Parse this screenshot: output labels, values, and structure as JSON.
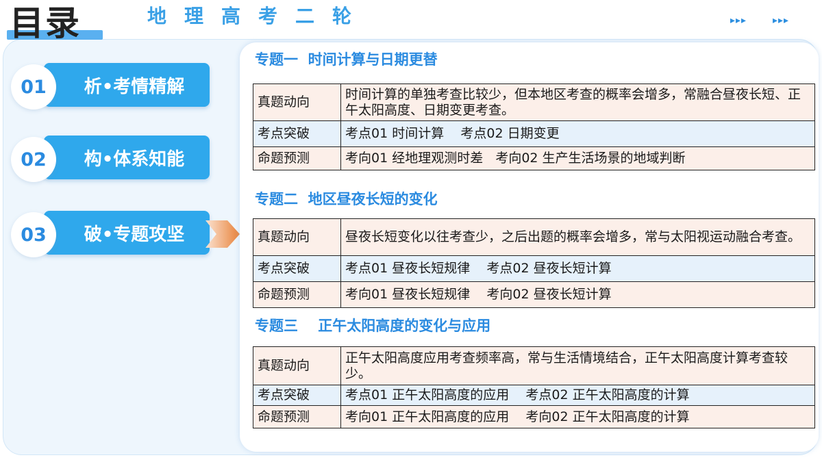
{
  "header": {
    "title": "目录",
    "subject": "地理高考二轮",
    "arrows_left": "▸▸▸",
    "arrows_right": "▸▸▸"
  },
  "nav": {
    "items": [
      {
        "number": "01",
        "label": "析•考情精解"
      },
      {
        "number": "02",
        "label": "构•体系知能"
      },
      {
        "number": "03",
        "label": "破•专题攻坚"
      }
    ],
    "active_index": 2
  },
  "topics": [
    {
      "title": "专题一  时间计算与日期更替",
      "rows": [
        {
          "label": "真题动向",
          "value": "时间计算的单独考查比较少，但本地区考查的概率会增多，常融合昼夜长短、正午太阳高度、日期变更考查。"
        },
        {
          "label": "考点突破",
          "value": "考点01 时间计算    考点02 日期变更"
        },
        {
          "label": "命题预测",
          "value": "考向01 经地理观测时差   考向02 生产生活场景的地域判断"
        }
      ]
    },
    {
      "title": "专题二  地区昼夜长短的变化",
      "rows": [
        {
          "label": "真题动向",
          "value": "昼夜长短变化以往考查少，之后出题的概率会增多，常与太阳视运动融合考查。"
        },
        {
          "label": "考点突破",
          "value": "考点01 昼夜长短规律    考点02 昼夜长短计算"
        },
        {
          "label": "命题预测",
          "value": "考向01 昼夜长短规律    考向02 昼夜长短计算"
        }
      ]
    },
    {
      "title": "专题三    正午太阳高度的变化与应用",
      "rows": [
        {
          "label": "真题动向",
          "value": "正午太阳高度应用考查频率高，常与生活情境结合，正午太阳高度计算考查较少。"
        },
        {
          "label": "考点突破",
          "value": "考点01 正午太阳高度的应用    考点02 正午太阳高度的计算"
        },
        {
          "label": "命题预测",
          "value": "考向01 正午太阳高度的应用    考向02 正午太阳高度的计算"
        }
      ]
    }
  ],
  "colors": {
    "accent": "#2fa8ec",
    "title_blue": "#2b8be0",
    "row_pink": "#fcefe9",
    "row_blue": "#e6f1fb",
    "pointer": "#e8823a"
  }
}
